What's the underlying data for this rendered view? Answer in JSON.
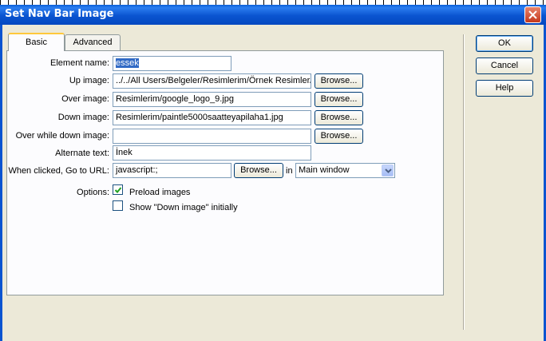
{
  "window": {
    "title": "Set Nav Bar Image"
  },
  "tabs": [
    {
      "label": "Basic"
    },
    {
      "label": "Advanced"
    }
  ],
  "form": {
    "element_name": {
      "label": "Element name:",
      "value": "essek"
    },
    "up_image": {
      "label": "Up image:",
      "value": "../../All Users/Belgeler/Resimlerim/Örnek Resimler/",
      "browse": "Browse..."
    },
    "over_image": {
      "label": "Over image:",
      "value": "Resimlerim/google_logo_9.jpg",
      "browse": "Browse..."
    },
    "down_image": {
      "label": "Down image:",
      "value": "Resimlerim/paintle5000saatteyapilaha1.jpg",
      "browse": "Browse..."
    },
    "over_while_down": {
      "label": "Over while down image:",
      "value": "",
      "browse": "Browse..."
    },
    "alternate_text": {
      "label": "Alternate text:",
      "value": "İnek"
    },
    "url": {
      "label": "When clicked, Go to URL:",
      "value": "javascript:;",
      "browse": "Browse...",
      "in_label": "in",
      "target": "Main window"
    },
    "options": {
      "label": "Options:",
      "preload": {
        "label": "Preload images",
        "checked": true
      },
      "show_down": {
        "label": "Show \"Down image\" initially",
        "checked": false
      }
    }
  },
  "buttons": {
    "ok": "OK",
    "cancel": "Cancel",
    "help": "Help"
  },
  "icons": {
    "close": "close-icon",
    "check": "check-icon",
    "dropdown": "chevron-down-icon"
  },
  "colors": {
    "titlebar": "#0a54d0",
    "dialog_bg": "#ECE9D8",
    "selection": "#316ac5",
    "tab_accent": "#ffc83c",
    "close_button": "#c4381d"
  }
}
